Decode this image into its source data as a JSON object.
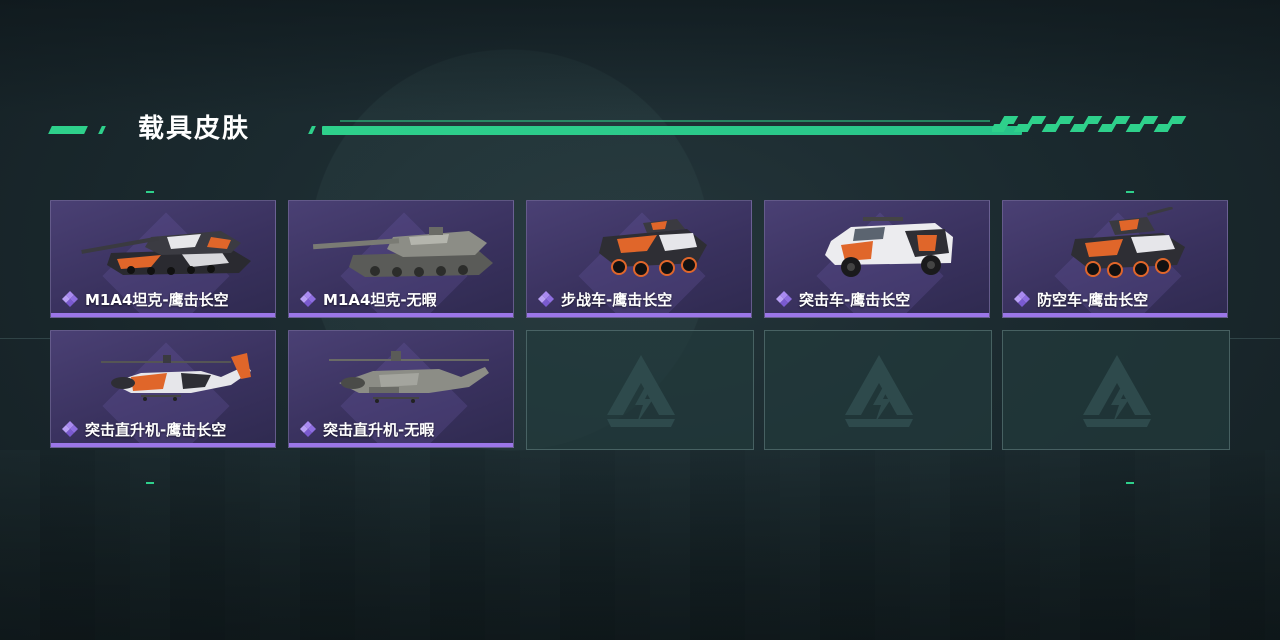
{
  "section": {
    "title": "载具皮肤"
  },
  "colors": {
    "accent": "#2ed08b",
    "card_underline": "#9b76e8",
    "card_bg": "#3a325f",
    "empty_bg": "#223a3c"
  },
  "skins": [
    {
      "label": "M1A4坦克-鹰击长空",
      "vehicle": "tank",
      "finish": "orange-camo",
      "rarity_icon": "purple-diamond-icon"
    },
    {
      "label": "M1A4坦克-无暇",
      "vehicle": "tank",
      "finish": "plain-grey",
      "rarity_icon": "purple-diamond-icon"
    },
    {
      "label": "步战车-鹰击长空",
      "vehicle": "ifv",
      "finish": "orange-camo",
      "rarity_icon": "purple-diamond-icon"
    },
    {
      "label": "突击车-鹰击长空",
      "vehicle": "assault-car",
      "finish": "orange-camo",
      "rarity_icon": "purple-diamond-icon"
    },
    {
      "label": "防空车-鹰击长空",
      "vehicle": "aa-vehicle",
      "finish": "orange-camo",
      "rarity_icon": "purple-diamond-icon"
    },
    {
      "label": "突击直升机-鹰击长空",
      "vehicle": "helicopter",
      "finish": "orange-camo",
      "rarity_icon": "purple-diamond-icon"
    },
    {
      "label": "突击直升机-无暇",
      "vehicle": "helicopter",
      "finish": "plain-grey",
      "rarity_icon": "purple-diamond-icon"
    }
  ],
  "empty_slots": [
    {
      "icon": "game-logo-icon"
    },
    {
      "icon": "game-logo-icon"
    },
    {
      "icon": "game-logo-icon"
    }
  ]
}
